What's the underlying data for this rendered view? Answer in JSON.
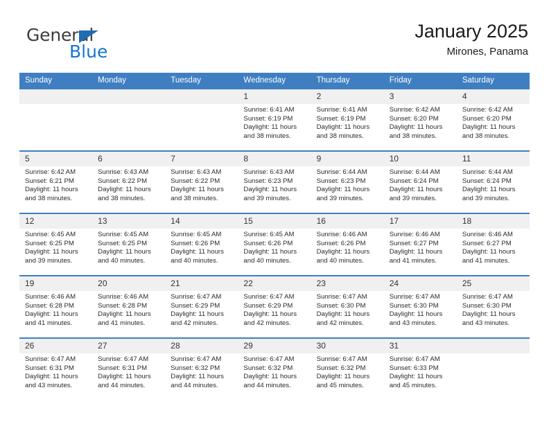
{
  "logo": {
    "text_primary": "General",
    "text_secondary": "Blue",
    "triangle_color": "#1f6cb5",
    "secondary_color": "#1477cf"
  },
  "header": {
    "title": "January 2025",
    "subtitle": "Mirones, Panama",
    "header_bar_color": "#3f7fc1",
    "daynum_band_color": "#f0f0f0"
  },
  "weekdays": [
    "Sunday",
    "Monday",
    "Tuesday",
    "Wednesday",
    "Thursday",
    "Friday",
    "Saturday"
  ],
  "labels": {
    "sunrise_prefix": "Sunrise:",
    "sunset_prefix": "Sunset:",
    "daylight_prefix": "Daylight:"
  },
  "weeks": [
    [
      {
        "day": "",
        "lines": []
      },
      {
        "day": "",
        "lines": []
      },
      {
        "day": "",
        "lines": []
      },
      {
        "day": "1",
        "lines": [
          "Sunrise: 6:41 AM",
          "Sunset: 6:19 PM",
          "Daylight: 11 hours",
          "and 38 minutes."
        ]
      },
      {
        "day": "2",
        "lines": [
          "Sunrise: 6:41 AM",
          "Sunset: 6:19 PM",
          "Daylight: 11 hours",
          "and 38 minutes."
        ]
      },
      {
        "day": "3",
        "lines": [
          "Sunrise: 6:42 AM",
          "Sunset: 6:20 PM",
          "Daylight: 11 hours",
          "and 38 minutes."
        ]
      },
      {
        "day": "4",
        "lines": [
          "Sunrise: 6:42 AM",
          "Sunset: 6:20 PM",
          "Daylight: 11 hours",
          "and 38 minutes."
        ]
      }
    ],
    [
      {
        "day": "5",
        "lines": [
          "Sunrise: 6:42 AM",
          "Sunset: 6:21 PM",
          "Daylight: 11 hours",
          "and 38 minutes."
        ]
      },
      {
        "day": "6",
        "lines": [
          "Sunrise: 6:43 AM",
          "Sunset: 6:22 PM",
          "Daylight: 11 hours",
          "and 38 minutes."
        ]
      },
      {
        "day": "7",
        "lines": [
          "Sunrise: 6:43 AM",
          "Sunset: 6:22 PM",
          "Daylight: 11 hours",
          "and 38 minutes."
        ]
      },
      {
        "day": "8",
        "lines": [
          "Sunrise: 6:43 AM",
          "Sunset: 6:23 PM",
          "Daylight: 11 hours",
          "and 39 minutes."
        ]
      },
      {
        "day": "9",
        "lines": [
          "Sunrise: 6:44 AM",
          "Sunset: 6:23 PM",
          "Daylight: 11 hours",
          "and 39 minutes."
        ]
      },
      {
        "day": "10",
        "lines": [
          "Sunrise: 6:44 AM",
          "Sunset: 6:24 PM",
          "Daylight: 11 hours",
          "and 39 minutes."
        ]
      },
      {
        "day": "11",
        "lines": [
          "Sunrise: 6:44 AM",
          "Sunset: 6:24 PM",
          "Daylight: 11 hours",
          "and 39 minutes."
        ]
      }
    ],
    [
      {
        "day": "12",
        "lines": [
          "Sunrise: 6:45 AM",
          "Sunset: 6:25 PM",
          "Daylight: 11 hours",
          "and 39 minutes."
        ]
      },
      {
        "day": "13",
        "lines": [
          "Sunrise: 6:45 AM",
          "Sunset: 6:25 PM",
          "Daylight: 11 hours",
          "and 40 minutes."
        ]
      },
      {
        "day": "14",
        "lines": [
          "Sunrise: 6:45 AM",
          "Sunset: 6:26 PM",
          "Daylight: 11 hours",
          "and 40 minutes."
        ]
      },
      {
        "day": "15",
        "lines": [
          "Sunrise: 6:45 AM",
          "Sunset: 6:26 PM",
          "Daylight: 11 hours",
          "and 40 minutes."
        ]
      },
      {
        "day": "16",
        "lines": [
          "Sunrise: 6:46 AM",
          "Sunset: 6:26 PM",
          "Daylight: 11 hours",
          "and 40 minutes."
        ]
      },
      {
        "day": "17",
        "lines": [
          "Sunrise: 6:46 AM",
          "Sunset: 6:27 PM",
          "Daylight: 11 hours",
          "and 41 minutes."
        ]
      },
      {
        "day": "18",
        "lines": [
          "Sunrise: 6:46 AM",
          "Sunset: 6:27 PM",
          "Daylight: 11 hours",
          "and 41 minutes."
        ]
      }
    ],
    [
      {
        "day": "19",
        "lines": [
          "Sunrise: 6:46 AM",
          "Sunset: 6:28 PM",
          "Daylight: 11 hours",
          "and 41 minutes."
        ]
      },
      {
        "day": "20",
        "lines": [
          "Sunrise: 6:46 AM",
          "Sunset: 6:28 PM",
          "Daylight: 11 hours",
          "and 41 minutes."
        ]
      },
      {
        "day": "21",
        "lines": [
          "Sunrise: 6:47 AM",
          "Sunset: 6:29 PM",
          "Daylight: 11 hours",
          "and 42 minutes."
        ]
      },
      {
        "day": "22",
        "lines": [
          "Sunrise: 6:47 AM",
          "Sunset: 6:29 PM",
          "Daylight: 11 hours",
          "and 42 minutes."
        ]
      },
      {
        "day": "23",
        "lines": [
          "Sunrise: 6:47 AM",
          "Sunset: 6:30 PM",
          "Daylight: 11 hours",
          "and 42 minutes."
        ]
      },
      {
        "day": "24",
        "lines": [
          "Sunrise: 6:47 AM",
          "Sunset: 6:30 PM",
          "Daylight: 11 hours",
          "and 43 minutes."
        ]
      },
      {
        "day": "25",
        "lines": [
          "Sunrise: 6:47 AM",
          "Sunset: 6:30 PM",
          "Daylight: 11 hours",
          "and 43 minutes."
        ]
      }
    ],
    [
      {
        "day": "26",
        "lines": [
          "Sunrise: 6:47 AM",
          "Sunset: 6:31 PM",
          "Daylight: 11 hours",
          "and 43 minutes."
        ]
      },
      {
        "day": "27",
        "lines": [
          "Sunrise: 6:47 AM",
          "Sunset: 6:31 PM",
          "Daylight: 11 hours",
          "and 44 minutes."
        ]
      },
      {
        "day": "28",
        "lines": [
          "Sunrise: 6:47 AM",
          "Sunset: 6:32 PM",
          "Daylight: 11 hours",
          "and 44 minutes."
        ]
      },
      {
        "day": "29",
        "lines": [
          "Sunrise: 6:47 AM",
          "Sunset: 6:32 PM",
          "Daylight: 11 hours",
          "and 44 minutes."
        ]
      },
      {
        "day": "30",
        "lines": [
          "Sunrise: 6:47 AM",
          "Sunset: 6:32 PM",
          "Daylight: 11 hours",
          "and 45 minutes."
        ]
      },
      {
        "day": "31",
        "lines": [
          "Sunrise: 6:47 AM",
          "Sunset: 6:33 PM",
          "Daylight: 11 hours",
          "and 45 minutes."
        ]
      },
      {
        "day": "",
        "lines": []
      }
    ]
  ]
}
